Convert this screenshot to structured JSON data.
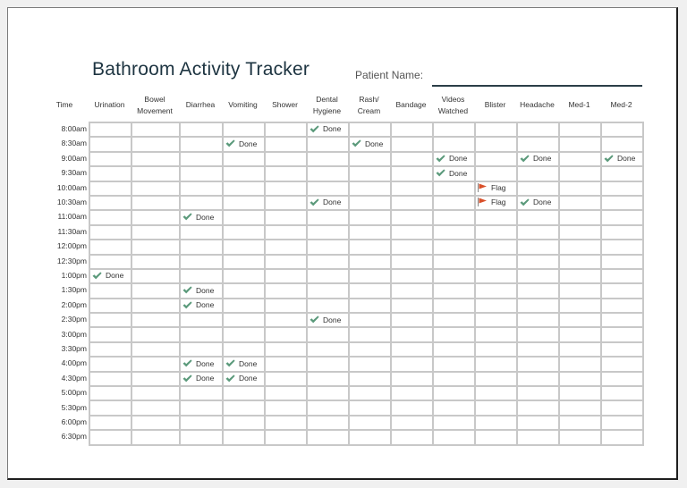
{
  "title": "Bathroom Activity Tracker",
  "patient_label": "Patient Name:",
  "patient_name": "",
  "time_header": "Time",
  "columns": [
    "Urination",
    "Bowel\nMovement",
    "Diarrhea",
    "Vomiting",
    "Shower",
    "Dental\nHygiene",
    "Rash/\nCream",
    "Bandage",
    "Videos\nWatched",
    "Blister",
    "Headache",
    "Med-1",
    "Med-2"
  ],
  "times": [
    "8:00am",
    "8:30am",
    "9:00am",
    "9:30am",
    "10:00am",
    "10:30am",
    "11:00am",
    "11:30am",
    "12:00pm",
    "12:30pm",
    "1:00pm",
    "1:30pm",
    "2:00pm",
    "2:30pm",
    "3:00pm",
    "3:30pm",
    "4:00pm",
    "4:30pm",
    "5:00pm",
    "5:30pm",
    "6:00pm",
    "6:30pm"
  ],
  "mark_labels": {
    "done": "Done",
    "flag": "Flag"
  },
  "mark_icons": {
    "done": "check-icon",
    "flag": "flag-icon"
  },
  "colors": {
    "check": "#5b9a7b",
    "flag": "#d9502a",
    "title": "#1d3441",
    "grid": "#c8c8c8"
  },
  "entries": [
    {
      "time": "8:00am",
      "column": "Dental\nHygiene",
      "status": "done"
    },
    {
      "time": "8:30am",
      "column": "Vomiting",
      "status": "done"
    },
    {
      "time": "8:30am",
      "column": "Rash/\nCream",
      "status": "done"
    },
    {
      "time": "9:00am",
      "column": "Videos\nWatched",
      "status": "done"
    },
    {
      "time": "9:00am",
      "column": "Headache",
      "status": "done"
    },
    {
      "time": "9:00am",
      "column": "Med-2",
      "status": "done"
    },
    {
      "time": "9:30am",
      "column": "Videos\nWatched",
      "status": "done"
    },
    {
      "time": "10:00am",
      "column": "Blister",
      "status": "flag"
    },
    {
      "time": "10:30am",
      "column": "Dental\nHygiene",
      "status": "done"
    },
    {
      "time": "10:30am",
      "column": "Blister",
      "status": "flag"
    },
    {
      "time": "10:30am",
      "column": "Headache",
      "status": "done"
    },
    {
      "time": "11:00am",
      "column": "Diarrhea",
      "status": "done"
    },
    {
      "time": "1:00pm",
      "column": "Urination",
      "status": "done"
    },
    {
      "time": "1:30pm",
      "column": "Diarrhea",
      "status": "done"
    },
    {
      "time": "2:00pm",
      "column": "Diarrhea",
      "status": "done"
    },
    {
      "time": "2:30pm",
      "column": "Dental\nHygiene",
      "status": "done"
    },
    {
      "time": "4:00pm",
      "column": "Diarrhea",
      "status": "done"
    },
    {
      "time": "4:00pm",
      "column": "Vomiting",
      "status": "done"
    },
    {
      "time": "4:30pm",
      "column": "Diarrhea",
      "status": "done"
    },
    {
      "time": "4:30pm",
      "column": "Vomiting",
      "status": "done"
    }
  ]
}
